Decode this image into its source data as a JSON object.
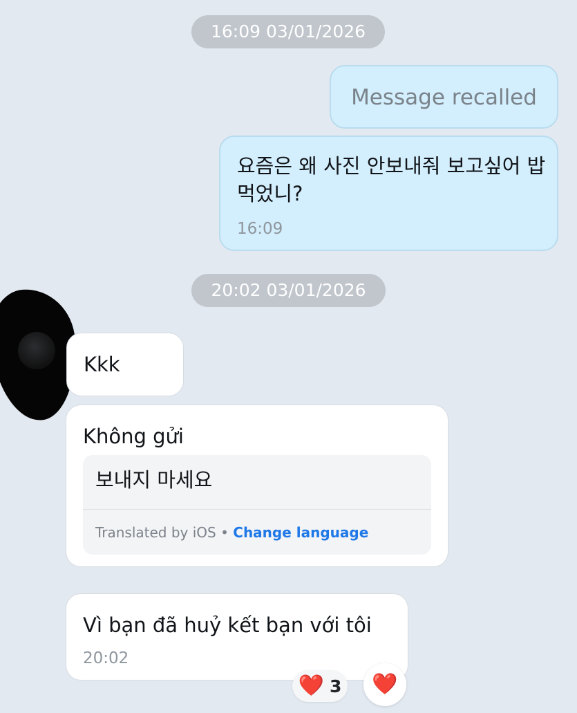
{
  "conversation": {
    "separators": [
      {
        "label": "16:09 03/01/2026"
      },
      {
        "label": "20:02 03/01/2026"
      }
    ],
    "outgoing": [
      {
        "text": "Message recalled",
        "recalled": true
      },
      {
        "text": "요즘은 왜 사진 안보내줘 보고싶어 밥먹었니?",
        "time": "16:09"
      }
    ],
    "incoming": [
      {
        "text": "Kkk"
      },
      {
        "text": "Không gửi",
        "translation": {
          "text": "보내지 마세요",
          "provider": "Translated by iOS",
          "separator": "•",
          "action": "Change language"
        }
      },
      {
        "text": "Vì bạn đã huỷ kết bạn với tôi",
        "time": "20:02"
      }
    ]
  },
  "reactions": {
    "summary": {
      "icon": "heart-icon",
      "emoji": "❤️",
      "count": "3"
    },
    "button": {
      "icon": "heart-icon",
      "emoji": "❤️"
    }
  },
  "colors": {
    "background": "#e3e9f1",
    "outgoing_bubble": "#d3eefc",
    "incoming_bubble": "#ffffff",
    "timestamp_pill": "#c1c6cd",
    "link": "#1f78e8",
    "heart": "#e51d2c"
  }
}
